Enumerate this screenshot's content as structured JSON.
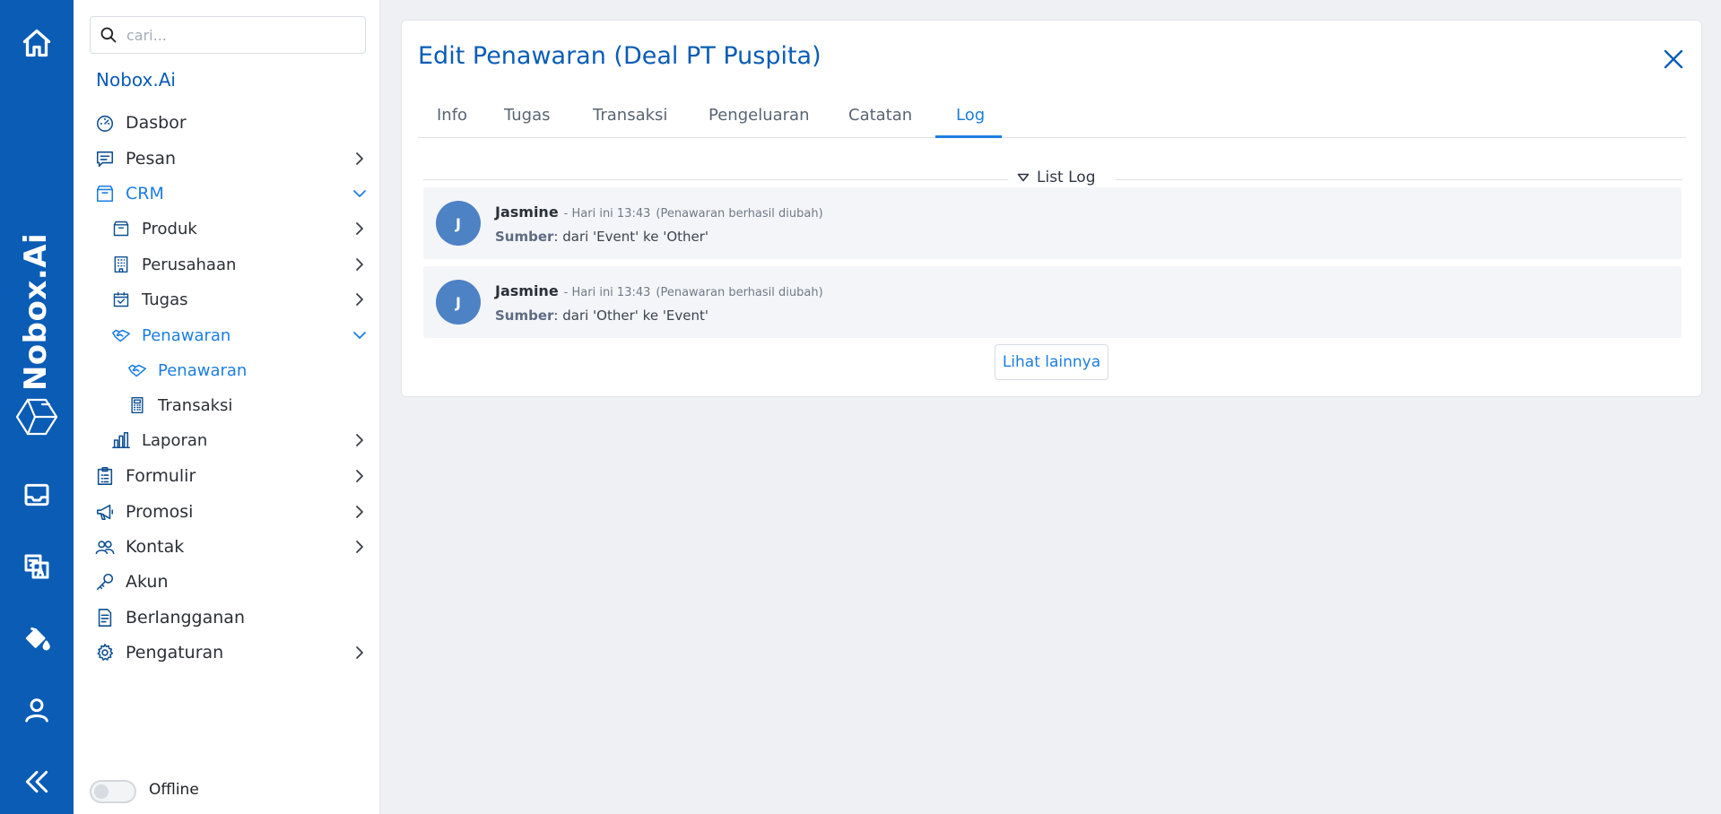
{
  "rail": {
    "brand": "Nobox.Ai",
    "icons": [
      "home-icon",
      "nobox-logo-icon",
      "inbox-icon",
      "translate-icon",
      "paint-bucket-icon",
      "user-icon",
      "collapse-icon"
    ]
  },
  "sidebar": {
    "search_placeholder": "cari...",
    "org_name": "Nobox.Ai",
    "items": [
      {
        "label": "Dasbor",
        "icon": "dashboard-icon"
      },
      {
        "label": "Pesan",
        "icon": "message-icon"
      },
      {
        "label": "CRM",
        "icon": "box-icon"
      },
      {
        "label": "Produk",
        "icon": "box-icon"
      },
      {
        "label": "Perusahaan",
        "icon": "building-icon"
      },
      {
        "label": "Tugas",
        "icon": "calendar-check-icon"
      },
      {
        "label": "Penawaran",
        "icon": "handshake-icon"
      },
      {
        "label": "Penawaran",
        "icon": "handshake-icon"
      },
      {
        "label": "Transaksi",
        "icon": "calculator-icon"
      },
      {
        "label": "Laporan",
        "icon": "bar-chart-icon"
      },
      {
        "label": "Formulir",
        "icon": "clipboard-icon"
      },
      {
        "label": "Promosi",
        "icon": "megaphone-icon"
      },
      {
        "label": "Kontak",
        "icon": "users-icon"
      },
      {
        "label": "Akun",
        "icon": "key-icon"
      },
      {
        "label": "Berlangganan",
        "icon": "document-icon"
      },
      {
        "label": "Pengaturan",
        "icon": "gear-icon"
      }
    ],
    "offline_label": "Offline"
  },
  "main": {
    "title": "Edit Penawaran (Deal PT Puspita)",
    "tabs": [
      "Info",
      "Tugas",
      "Transaksi",
      "Pengeluaran",
      "Catatan",
      "Log"
    ],
    "active_tab": "Log",
    "section_label": "List Log",
    "logs": [
      {
        "initial": "J",
        "user": "Jasmine",
        "time": "- Hari ini 13:43",
        "action": "(Penawaran berhasil diubah)",
        "field": "Sumber",
        "detail": ": dari 'Event' ke 'Other'"
      },
      {
        "initial": "J",
        "user": "Jasmine",
        "time": "- Hari ini 13:43",
        "action": "(Penawaran berhasil diubah)",
        "field": "Sumber",
        "detail": ": dari 'Other' ke 'Event'"
      }
    ],
    "more_button": "Lihat lainnya"
  },
  "colors": {
    "brand_blue": "#0b5cb5",
    "accent_blue": "#1d7ee0",
    "avatar_blue": "#4d82c4",
    "background": "#eff0f4"
  }
}
